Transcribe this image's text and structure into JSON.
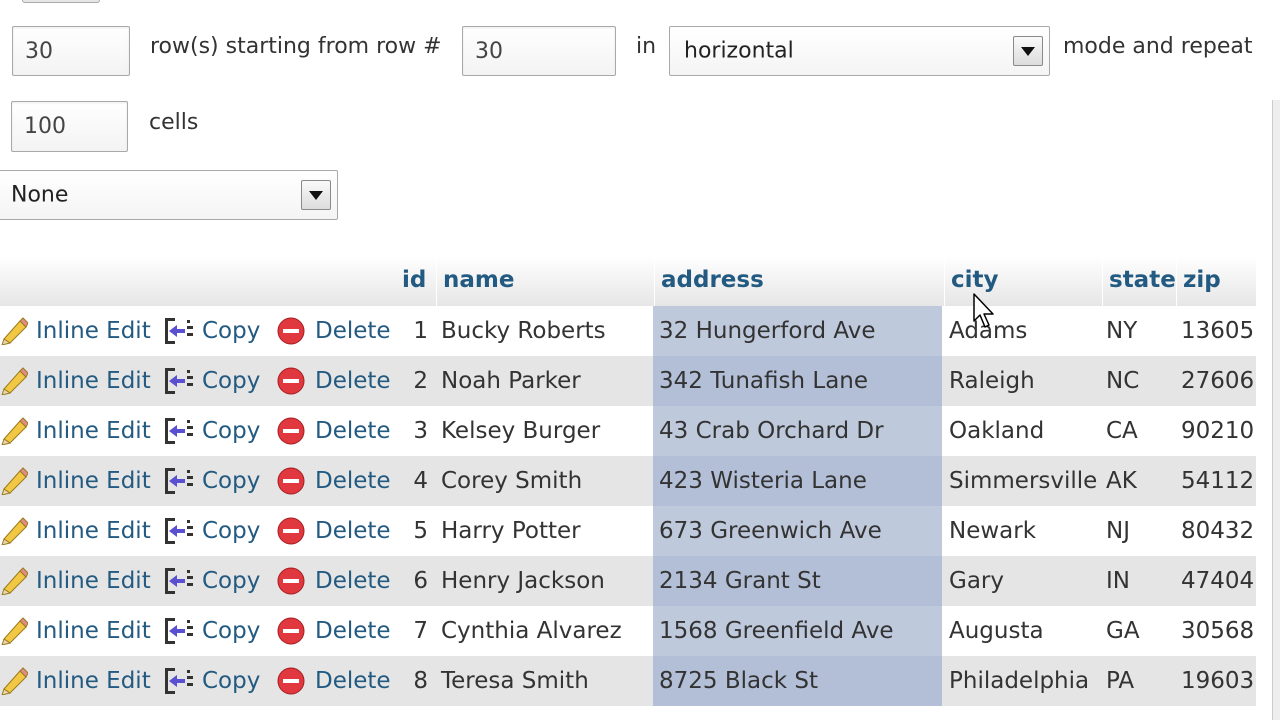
{
  "controls": {
    "rows_value": "30",
    "rows_label": "row(s) starting from row #",
    "start_value": "30",
    "in_label": "in",
    "mode_selected": "horizontal",
    "mode_label": "mode and repeat",
    "headers_every_value": "100",
    "cells_label": "cells",
    "action_select": "None"
  },
  "actions": {
    "inline_edit": "Inline Edit",
    "copy": "Copy",
    "delete": "Delete"
  },
  "table": {
    "columns": [
      "id",
      "name",
      "address",
      "city",
      "state",
      "zip"
    ],
    "rows": [
      {
        "id": "1",
        "name": "Bucky Roberts",
        "address": "32 Hungerford Ave",
        "city": "Adams",
        "state": "NY",
        "zip": "13605"
      },
      {
        "id": "2",
        "name": "Noah Parker",
        "address": "342 Tunafish Lane",
        "city": "Raleigh",
        "state": "NC",
        "zip": "27606"
      },
      {
        "id": "3",
        "name": "Kelsey Burger",
        "address": "43 Crab Orchard Dr",
        "city": "Oakland",
        "state": "CA",
        "zip": "90210"
      },
      {
        "id": "4",
        "name": "Corey Smith",
        "address": "423 Wisteria Lane",
        "city": "Simmersville",
        "state": "AK",
        "zip": "54112"
      },
      {
        "id": "5",
        "name": "Harry Potter",
        "address": "673 Greenwich Ave",
        "city": "Newark",
        "state": "NJ",
        "zip": "80432"
      },
      {
        "id": "6",
        "name": "Henry Jackson",
        "address": "2134 Grant St",
        "city": "Gary",
        "state": "IN",
        "zip": "47404"
      },
      {
        "id": "7",
        "name": "Cynthia Alvarez",
        "address": "1568 Greenfield Ave",
        "city": "Augusta",
        "state": "GA",
        "zip": "30568"
      },
      {
        "id": "8",
        "name": "Teresa Smith",
        "address": "8725 Black St",
        "city": "Philadelphia",
        "state": "PA",
        "zip": "19603"
      }
    ]
  },
  "icons": {
    "edit": "pencil-icon",
    "copy": "copy-insert-icon",
    "delete": "delete-circle-icon"
  },
  "colors": {
    "link": "#235a81",
    "delete_red": "#e0383e",
    "address_highlight": "#bfc9dc",
    "row_alt": "#e5e5e5"
  }
}
